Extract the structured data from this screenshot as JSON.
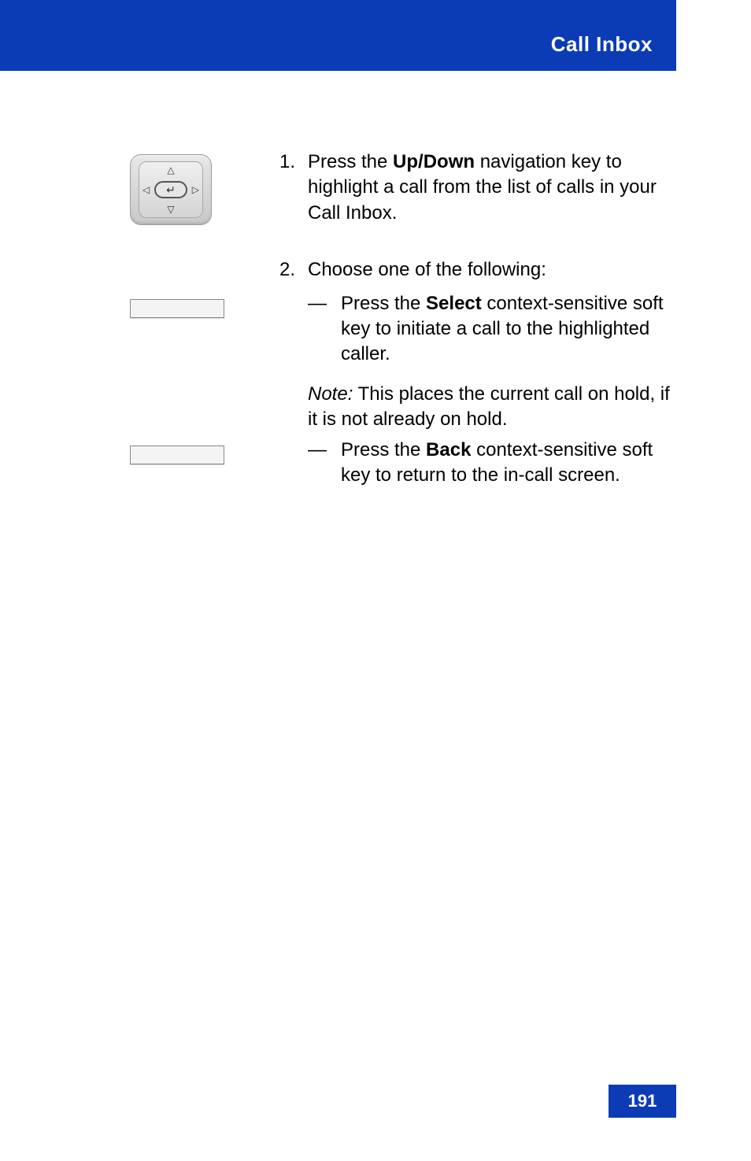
{
  "header": {
    "title": "Call Inbox"
  },
  "steps": {
    "step1": {
      "num": "1.",
      "pre": "Press the ",
      "key": "Up/Down",
      "post": " navigation key to highlight a call from the list of calls in your Call Inbox."
    },
    "step2": {
      "num": "2.",
      "intro": "Choose one of the following:",
      "optA": {
        "dash": "—",
        "pre": "Press the ",
        "key": "Select",
        "post": " context-sensitive soft key to initiate a call to the highlighted caller.",
        "note_label": "Note:",
        "note_text": " This places the current call on hold, if it is not already on hold."
      },
      "optB": {
        "dash": "—",
        "pre": "Press the ",
        "key": "Back",
        "post": " context-sensitive soft key to return to the in-call screen."
      }
    }
  },
  "footer": {
    "page": "191"
  }
}
